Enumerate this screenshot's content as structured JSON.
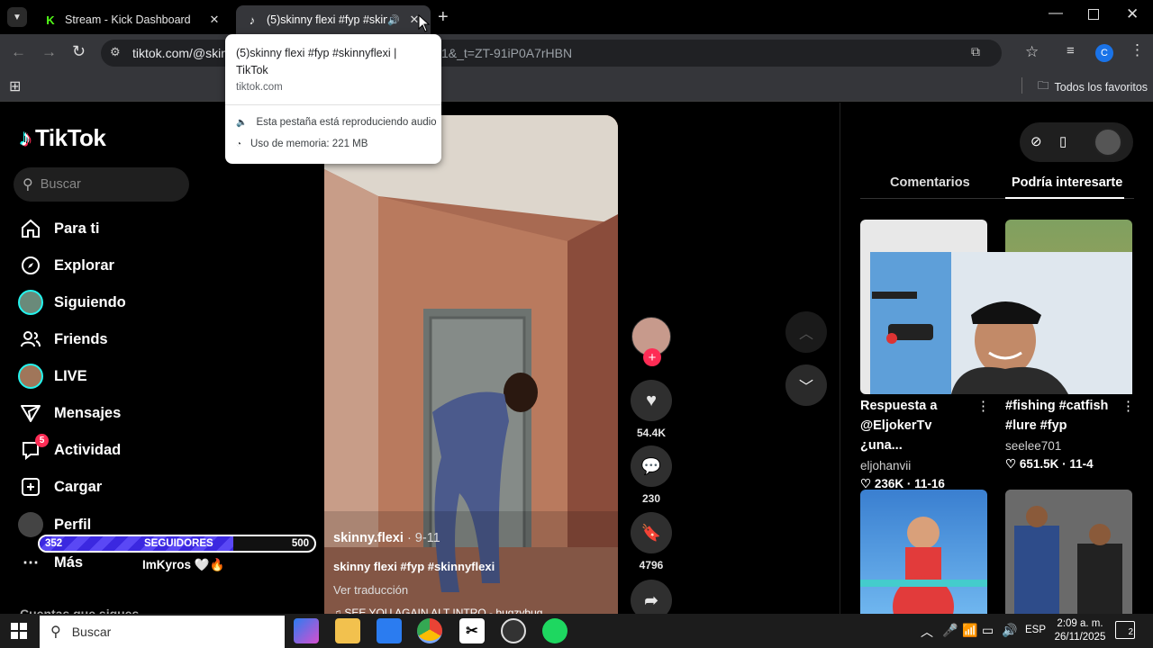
{
  "browser": {
    "tabs": [
      {
        "title": "Stream - Kick Dashboard",
        "favicon": "kick-icon",
        "active": false
      },
      {
        "title": "(5)skinny flexi #fyp #skinnyf",
        "favicon": "tiktok-icon",
        "active": true
      }
    ],
    "url": "tiktok.com/@skin",
    "url_tail": "1&_t=ZT-91iP0A7rHBN",
    "bookmarks_label": "Todos los favoritos",
    "profile_initial": "C",
    "hovercard": {
      "title": "(5)skinny flexi #fyp #skinnyflexi | TikTok",
      "domain": "tiktok.com",
      "audio_text": "Esta pestaña está reproduciendo audio",
      "memory_text": "Uso de memoria: 221 MB"
    }
  },
  "tiktok": {
    "logo": "TikTok",
    "search_placeholder": "Buscar",
    "nav": [
      {
        "label": "Para ti",
        "icon": "home-icon"
      },
      {
        "label": "Explorar",
        "icon": "compass-icon"
      },
      {
        "label": "Siguiendo",
        "icon": "following-avatar-icon"
      },
      {
        "label": "Friends",
        "icon": "friends-icon"
      },
      {
        "label": "LIVE",
        "icon": "live-avatar-icon"
      },
      {
        "label": "Mensajes",
        "icon": "send-icon"
      },
      {
        "label": "Actividad",
        "icon": "inbox-icon",
        "badge": "5"
      },
      {
        "label": "Cargar",
        "icon": "plus-box-icon"
      },
      {
        "label": "Perfil",
        "icon": "profile-avatar-icon"
      },
      {
        "label": "Más",
        "icon": "more-icon"
      }
    ],
    "following_accounts_label": "Cuentas que sigues",
    "video": {
      "author": "skinny.flexi",
      "date": "9-11",
      "caption": "skinny flexi #fyp #skinnyflexi",
      "translate": "Ver traducción",
      "music": "SEE YOU AGAIN ALT INTRO - bugzybug"
    },
    "actions": {
      "likes": "54.4K",
      "comments": "230",
      "saves": "4796"
    },
    "tabs": {
      "comments": "Comentarios",
      "suggested": "Podría interesarte"
    },
    "suggested": [
      {
        "title": "Respuesta a @EljokerTv ¿una...",
        "author": "eljohanvii",
        "likes": "236K",
        "date": "11-16"
      },
      {
        "title": "#fishing #catfish #lure #fyp",
        "author": "seelee701",
        "likes": "651.5K",
        "date": "11-4"
      }
    ]
  },
  "overlay": {
    "follower_goal": {
      "current": "352",
      "label": "SEGUIDORES",
      "target": "500",
      "progress": 0.704
    },
    "latest_follower": "ImKyros 🤍🔥"
  },
  "taskbar": {
    "search_placeholder": "Buscar",
    "language": "ESP",
    "time": "2:09 a. m.",
    "date": "26/11/2025",
    "notifications": "2"
  },
  "colors": {
    "tiktok_red": "#fe2c55",
    "goal_blue": "#3b28e0"
  }
}
